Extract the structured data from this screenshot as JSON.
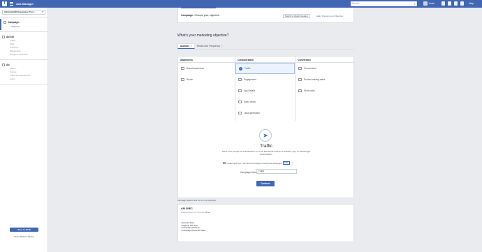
{
  "topbar": {
    "logo": "f",
    "app_title": "Ads Manager",
    "search_placeholder": "Search",
    "user_name": "Leah",
    "help": "Help"
  },
  "sidebar": {
    "account": "AdmartenNit Expansion Test ...",
    "sections": [
      {
        "title": "Campaign",
        "items": [
          "Objective"
        ]
      },
      {
        "title": "Ad Set",
        "items": [
          "Traffic",
          "Offer",
          "Audience",
          "Placements",
          "Budget & Schedule"
        ]
      },
      {
        "title": "Ad",
        "items": [
          "Pages",
          "Format",
          "Fullscreen Experience",
          "Links"
        ]
      }
    ],
    "save_draft": "Save to Draft",
    "close_without_saving": "Close Without Saving"
  },
  "campaign_header": {
    "label_bold": "Campaign",
    "label_rest": ": Choose your objective.",
    "quick_creation": "Switch to Quick Creation",
    "help_link": "Help: Choosing an Objective"
  },
  "objective": {
    "question": "What's your marketing objective?",
    "tabs": [
      "Auction",
      "Reach and Frequency"
    ],
    "columns": [
      {
        "head": "Awareness",
        "options": [
          "Brand awareness",
          "Reach"
        ]
      },
      {
        "head": "Consideration",
        "options": [
          "Traffic",
          "Engagement",
          "App installs",
          "Video views",
          "Lead generation"
        ]
      },
      {
        "head": "Conversion",
        "options": [
          "Conversions",
          "Product catalog sales",
          "Store visits"
        ]
      }
    ],
    "selected": "Traffic",
    "selected_title": "Traffic",
    "selected_desc": "Send more people to a destination on or off Facebook such as a website, app, or Messenger conversation.",
    "split_test": "Create Split Test: Use this ad campaign to test ad set strategies",
    "new_badge": "NEW",
    "campaign_name_label": "Campaign Name",
    "campaign_name_value": "Traffic",
    "continue": "Continue"
  },
  "spend": {
    "label": "Campaign Spend Limit",
    "link": "Set a Limit",
    "optional": "(optional)"
  },
  "spec": {
    "title": "API SPEC",
    "sub": "Make ad spec to prototype.",
    "reset": "Reset",
    "items": [
      "• Account Store",
      "• Adgroup API Spec",
      "• Campaign API Spec",
      "• Campaign Group API Spec"
    ]
  },
  "colors": {
    "brand": "#4267b2",
    "bg": "#e9ebee"
  }
}
